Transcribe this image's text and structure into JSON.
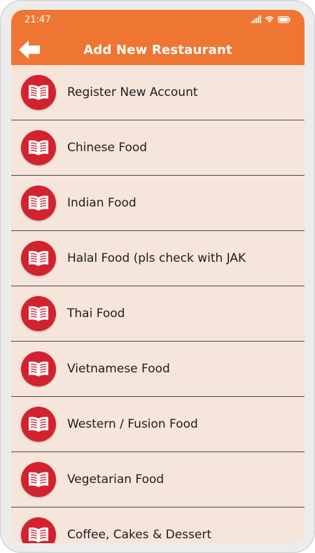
{
  "status_bar": {
    "time": "21:47"
  },
  "header": {
    "title": "Add New Restaurant",
    "back_icon": "arrow-left-icon",
    "background": "#ef7632"
  },
  "list": {
    "icon": "open-book-icon",
    "icon_color": "#d3222f",
    "items": [
      {
        "label": "Register New Account"
      },
      {
        "label": "Chinese Food"
      },
      {
        "label": "Indian Food"
      },
      {
        "label": "Halal Food (pls check with JAK"
      },
      {
        "label": "Thai Food"
      },
      {
        "label": "Vietnamese Food"
      },
      {
        "label": "Western / Fusion Food"
      },
      {
        "label": "Vegetarian Food"
      },
      {
        "label": "Coffee, Cakes & Dessert"
      }
    ]
  }
}
